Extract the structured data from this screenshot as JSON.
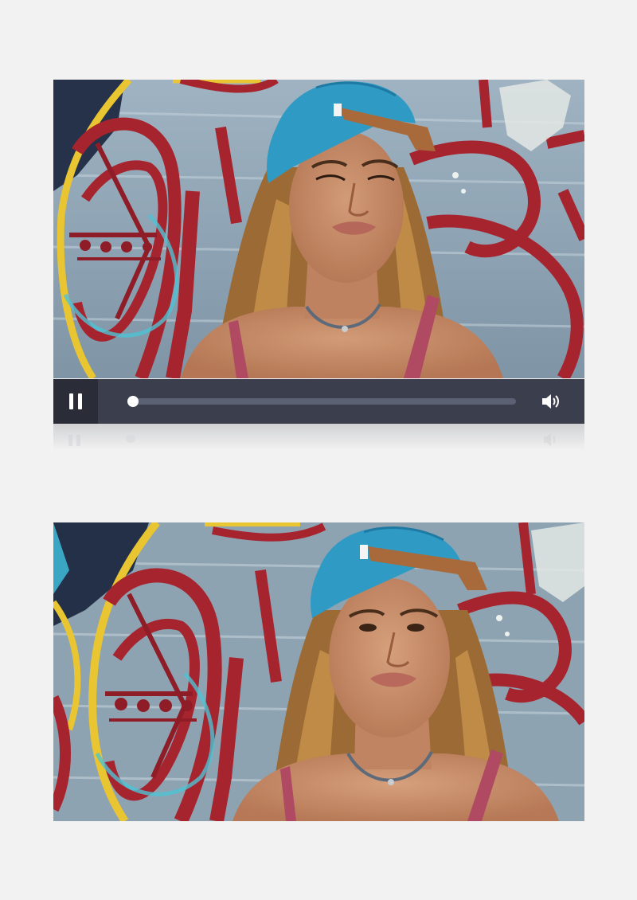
{
  "player": {
    "playing": true,
    "progress_fraction": 0.01,
    "pause_icon": "pause-icon",
    "volume_icon": "volume-icon",
    "colors": {
      "controls_bg": "#3b3f4d",
      "button_bg": "#2a2d37",
      "track": "#5b6072",
      "knob": "#ffffff",
      "page_bg": "#f2f2f2"
    }
  }
}
